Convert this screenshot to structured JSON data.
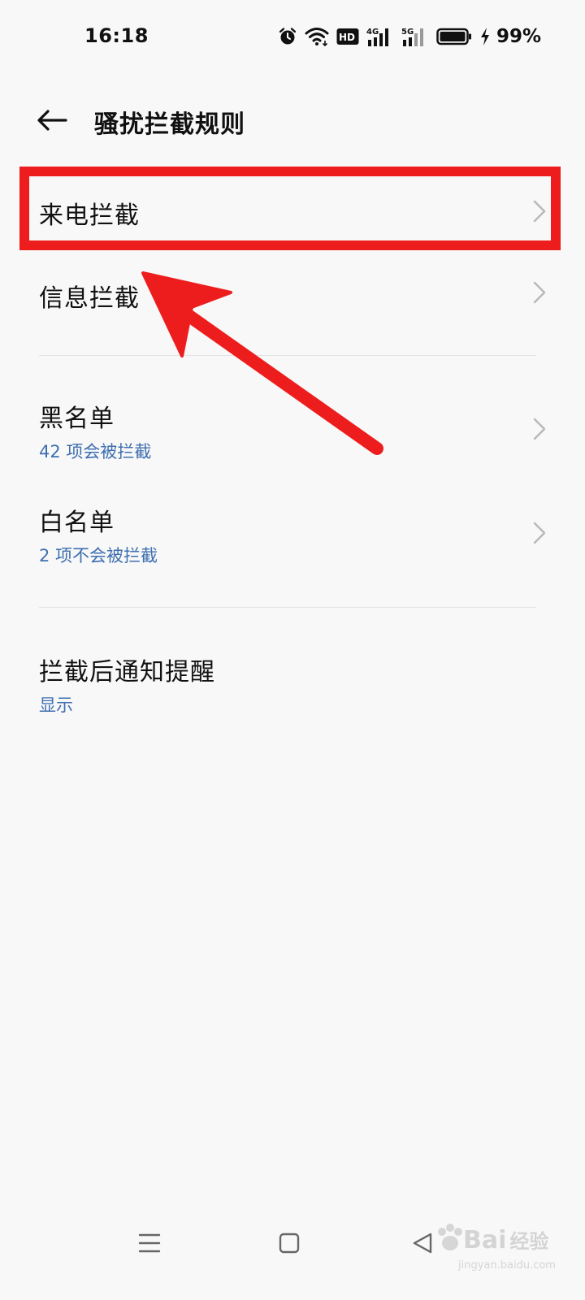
{
  "status_bar": {
    "time": "16:18",
    "battery_percent": "99%",
    "icons": [
      "alarm-icon",
      "wifi-icon",
      "hd-icon",
      "signal-4g-icon",
      "signal-5g-icon",
      "battery-icon",
      "charging-icon"
    ],
    "signal_labels": {
      "hd": "HD",
      "g4": "4G",
      "g5": "5G"
    }
  },
  "header": {
    "title": "骚扰拦截规则",
    "back_icon": "arrow-left-icon"
  },
  "rules": [
    {
      "title": "来电拦截"
    },
    {
      "title": "信息拦截"
    }
  ],
  "lists": [
    {
      "title": "黑名单",
      "subtitle": "42 项会被拦截"
    },
    {
      "title": "白名单",
      "subtitle": "2 项不会被拦截"
    }
  ],
  "notify": {
    "title": "拦截后通知提醒",
    "value": "显示"
  },
  "colors": {
    "accent_blue": "#3e6fb0",
    "annotation_red": "#ee1d1d",
    "background": "#f8f8f8"
  },
  "nav": {
    "icons": [
      "menu-icon",
      "home-square-icon",
      "back-triangle-icon"
    ]
  },
  "watermark": {
    "brand": "Bai",
    "brand_cn": "经验",
    "url": "jingyan.baidu.com"
  }
}
